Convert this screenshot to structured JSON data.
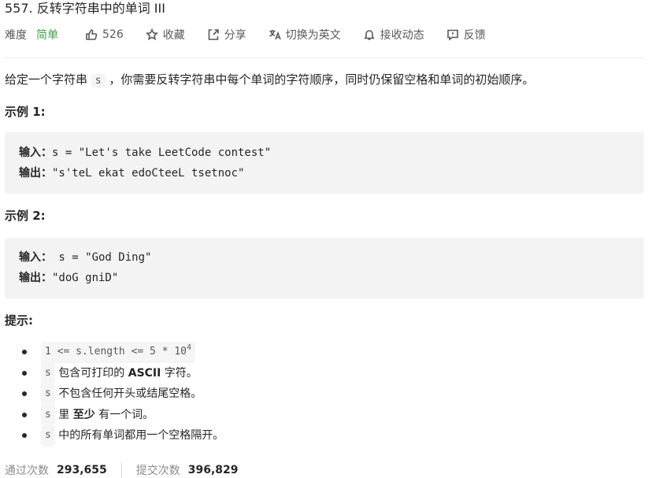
{
  "problem": {
    "title": "557. 反转字符串中的单词 III",
    "difficulty_label": "难度",
    "difficulty_value": "简单",
    "difficulty_color": "#43a047",
    "likes": "526",
    "favorite_label": "收藏",
    "share_label": "分享",
    "translate_label": "切换为英文",
    "subscribe_label": "接收动态",
    "feedback_label": "反馈"
  },
  "description": {
    "before_code": "给定一个字符串 ",
    "code": "s",
    "after_code": " ，你需要反转字符串中每个单词的字符顺序，同时仍保留空格和单词的初始顺序。"
  },
  "examples": [
    {
      "heading": "示例 1:",
      "input_label": "输入：",
      "input_value": "s = \"Let's take LeetCode contest\"",
      "output_label": "输出：",
      "output_value": "\"s'teL ekat edoCteeL tsetnoc\""
    },
    {
      "heading": "示例 2:",
      "input_label": "输入：",
      "input_value": " s = \"God Ding\"",
      "output_label": "输出：",
      "output_value": "\"doG gniD\""
    }
  ],
  "constraints": {
    "heading": "提示:",
    "items": [
      {
        "code": "1 <= s.length <= 5 * 10",
        "sup": "4"
      },
      {
        "code": "s",
        "pre_bold": " 包含可打印的 ",
        "bold": "ASCII",
        "post_bold": " 字符。"
      },
      {
        "code": "s",
        "text": " 不包含任何开头或结尾空格。"
      },
      {
        "code": "s",
        "pre_bold": " 里 ",
        "bold": "至少",
        "post_bold": " 有一个词。"
      },
      {
        "code": "s",
        "text": " 中的所有单词都用一个空格隔开。"
      }
    ]
  },
  "stats": {
    "accepted_label": "通过次数",
    "accepted_value": "293,655",
    "submitted_label": "提交次数",
    "submitted_value": "396,829"
  }
}
